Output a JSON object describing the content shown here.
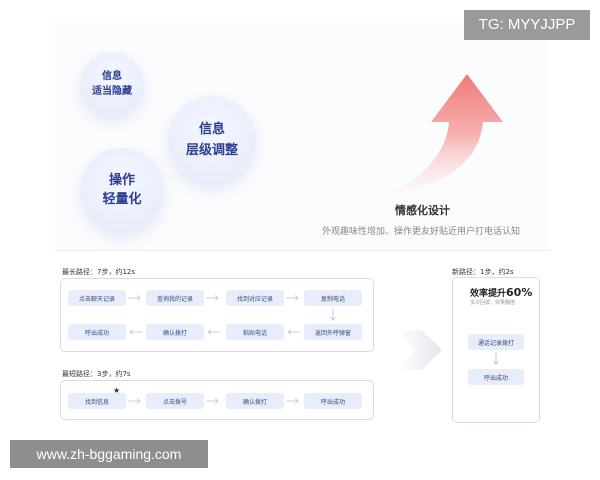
{
  "watermark_top": "TG: MYYJJPP",
  "watermark_bottom": "www.zh-bggaming.com",
  "bubbles": {
    "b1": [
      "信息",
      "适当隐藏"
    ],
    "b2": [
      "信息",
      "层级调整"
    ],
    "b3": [
      "操作",
      "轻量化"
    ]
  },
  "emotion": {
    "title": "情感化设计",
    "subtitle": "外观趣味性增加、操作更友好贴近用户打电话认知"
  },
  "longest_path": {
    "label": "最长路径：7步，约12s",
    "row1": [
      "点击聊天记录",
      "查询我的记录",
      "找到对应记录",
      "复制电话"
    ],
    "row2": [
      "呼出成功",
      "确认拨打",
      "粘贴电话",
      "返回外呼弹窗"
    ]
  },
  "shortest_path": {
    "label": "最短路径：3步，约7s",
    "row": [
      "找到信息",
      "点击拨号",
      "确认拨打",
      "呼出成功"
    ],
    "star": "★"
  },
  "new_path": {
    "label": "新路径：1步，约2s",
    "efficiency_prefix": "效率提升",
    "efficiency_value": "60%",
    "efficiency_sub": "多次回拨、效果翻倍",
    "nodes": [
      "通话记录拨打",
      "呼出成功"
    ]
  },
  "colors": {
    "node_bg": "#e8edfb",
    "border": "#d6dcee",
    "arrow_red": "#f07a7a",
    "bubble_text": "#2c3f8f"
  }
}
